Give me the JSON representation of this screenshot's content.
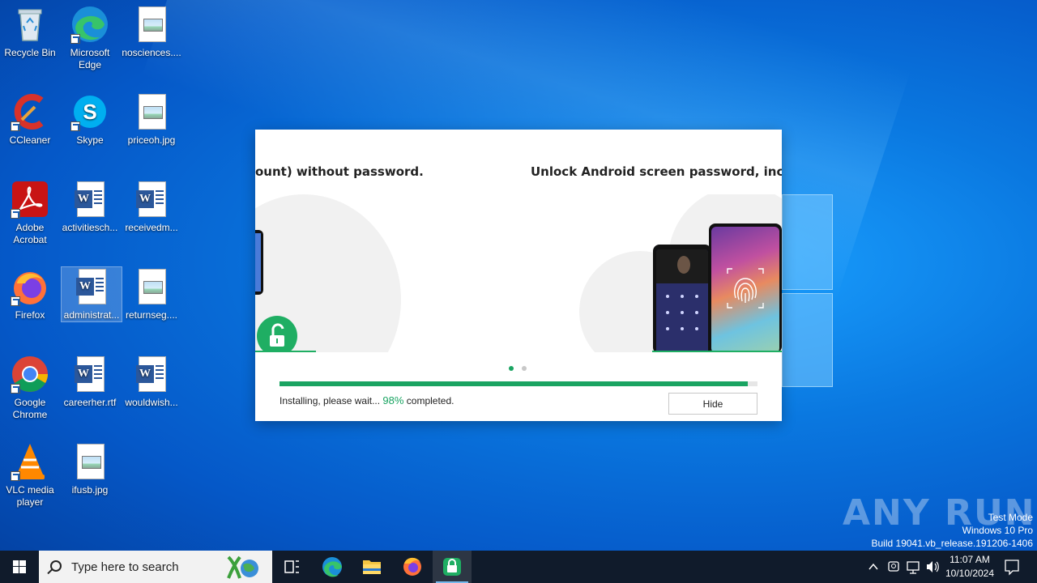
{
  "desktop": {
    "icons": [
      {
        "label": "Recycle Bin"
      },
      {
        "label": "Microsoft Edge"
      },
      {
        "label": "nosciences...."
      },
      {
        "label": "CCleaner"
      },
      {
        "label": "Skype"
      },
      {
        "label": "priceoh.jpg"
      },
      {
        "label": "Adobe Acrobat"
      },
      {
        "label": "activitiesch..."
      },
      {
        "label": "receivedm..."
      },
      {
        "label": "Firefox"
      },
      {
        "label": "administrat..."
      },
      {
        "label": "returnseg...."
      },
      {
        "label": "Google Chrome"
      },
      {
        "label": "careerher.rtf"
      },
      {
        "label": "wouldwish..."
      },
      {
        "label": "VLC media player"
      },
      {
        "label": "ifusb.jpg"
      }
    ]
  },
  "installer": {
    "slide_text_left": "ount) without password.",
    "slide_text_right": "Unlock Android screen password, includir",
    "progress": 0.98,
    "status_prefix": "Installing, please wait... ",
    "status_percent": "98%",
    "status_suffix": " completed.",
    "hide_label": "Hide",
    "accent_color": "#1aa462"
  },
  "watermark": {
    "brand": "ANY RUN",
    "line1": "Test Mode",
    "line2": "Windows 10 Pro",
    "line3": "Build 19041.vb_release.191206-1406"
  },
  "taskbar": {
    "search_placeholder": "Type here to search",
    "time": "11:07 AM",
    "date": "10/10/2024"
  }
}
